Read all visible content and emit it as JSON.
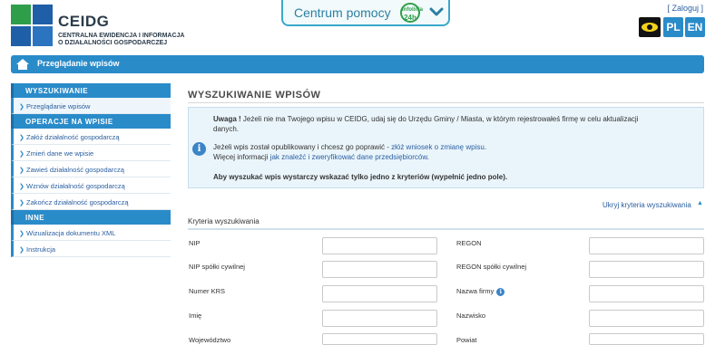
{
  "header": {
    "logo_name": "CEIDG",
    "logo_sub_1": "CENTRALNA EWIDENCJA I INFORMACJA",
    "logo_sub_2": "O DZIAŁALNOŚCI GOSPODARCZEJ",
    "help_label": "Centrum pomocy",
    "help_badge_top": "Infolinia",
    "help_badge_main": "24h",
    "login": "[ Zaloguj ]",
    "lang_pl": "PL",
    "lang_en": "EN"
  },
  "breadcrumb": {
    "label": "Przeglądanie wpisów"
  },
  "sidebar": {
    "sections": [
      {
        "title": "Wyszukiwanie",
        "items": [
          "Przeglądanie wpisów"
        ]
      },
      {
        "title": "Operacje na wpisie",
        "items": [
          "Załóż działalność gospodarczą",
          "Zmień dane we wpisie",
          "Zawieś działalność gospodarczą",
          "Wznów działalność gospodarczą",
          "Zakończ działalność gospodarczą"
        ]
      },
      {
        "title": "Inne",
        "items": [
          "Wizualizacja dokumentu XML",
          "Instrukcja"
        ]
      }
    ]
  },
  "main": {
    "title": "WYSZUKIWANIE WPISÓW",
    "info": {
      "warning_bold": "Uwaga !",
      "warning_text_1": " Jeżeli nie ma Twojego wpisu w CEIDG, udaj się do Urzędu Gminy / Miasta, w którym rejestrowałeś firmę w celu aktualizacji",
      "warning_text_2": "danych.",
      "published_text": "Jeżeli wpis został opublikowany i chcesz go poprawić - ",
      "published_link": "złóż wniosek o zmianę wpisu",
      "published_end": ".",
      "more_text": "Więcej informacji ",
      "more_link": "jak znaleźć i zweryfikować dane przedsiębiorców",
      "more_end": ".",
      "bold_note": "Aby wyszukać wpis wystarczy wskazać tylko jedno z kryteriów (wypełnić jedno pole)."
    },
    "hide_criteria": "Ukryj kryteria wyszukiwania",
    "criteria_title": "Kryteria wyszukiwania",
    "fields": {
      "nip": "NIP",
      "regon": "REGON",
      "nip_sc": "NIP spółki cywilnej",
      "regon_sc": "REGON spółki cywilnej",
      "krs": "Numer KRS",
      "firm_name": "Nazwa firmy",
      "first_name": "Imię",
      "last_name": "Nazwisko",
      "voivodeship": "Województwo",
      "county": "Powiat"
    }
  }
}
